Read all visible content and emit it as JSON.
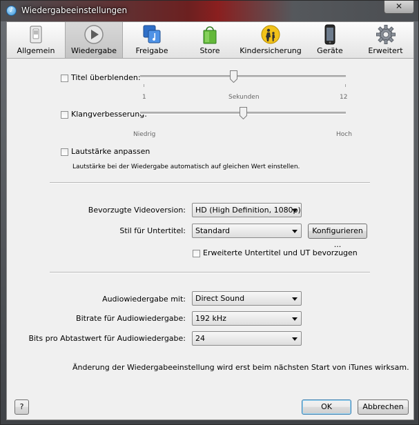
{
  "window": {
    "title": "Wiedergabeeinstellungen",
    "close_glyph": "✕",
    "app_icon": "itunes-icon"
  },
  "toolbar": {
    "items": [
      {
        "label": "Allgemein",
        "icon": "switch-icon"
      },
      {
        "label": "Wiedergabe",
        "icon": "play-icon",
        "active": true
      },
      {
        "label": "Freigabe",
        "icon": "music-share-icon"
      },
      {
        "label": "Store",
        "icon": "shopping-bag-icon"
      },
      {
        "label": "Kindersicherung",
        "icon": "parental-control-icon"
      },
      {
        "label": "Geräte",
        "icon": "device-icon"
      },
      {
        "label": "Erweitert",
        "icon": "gear-icon"
      }
    ]
  },
  "crossfade": {
    "label": "Titel überblenden:",
    "checked": false,
    "min_label": "1",
    "mid_label": "Sekunden",
    "max_label": "12",
    "value": 6,
    "min": 1,
    "max": 12
  },
  "sound_enhancer": {
    "label": "Klangverbesserung:",
    "checked": false,
    "low_label": "Niedrig",
    "high_label": "Hoch",
    "level": 0.5
  },
  "sound_check": {
    "label": "Lautstärke anpassen",
    "checked": false,
    "description": "Lautstärke bei der Wiedergabe automatisch auf gleichen Wert einstellen."
  },
  "video": {
    "label": "Bevorzugte Videoversion:",
    "value": "HD (High Definition, 1080p)"
  },
  "subtitles": {
    "label": "Stil für Untertitel:",
    "value": "Standard",
    "configure_label": "Konfigurieren ...",
    "cc_label": "Erweiterte Untertitel und UT bevorzugen",
    "cc_checked": false
  },
  "audio": {
    "output_label": "Audiowiedergabe mit:",
    "output_value": "Direct Sound",
    "bitrate_label": "Bitrate für Audiowiedergabe:",
    "bitrate_value": "192 kHz",
    "bits_label": "Bits pro Abtastwert für Audiowiedergabe:",
    "bits_value": "24"
  },
  "notice": "Änderung der Wiedergabeeinstellung wird erst beim nächsten Start von iTunes wirksam.",
  "footer": {
    "help_label": "?",
    "ok_label": "OK",
    "cancel_label": "Abbrechen"
  }
}
